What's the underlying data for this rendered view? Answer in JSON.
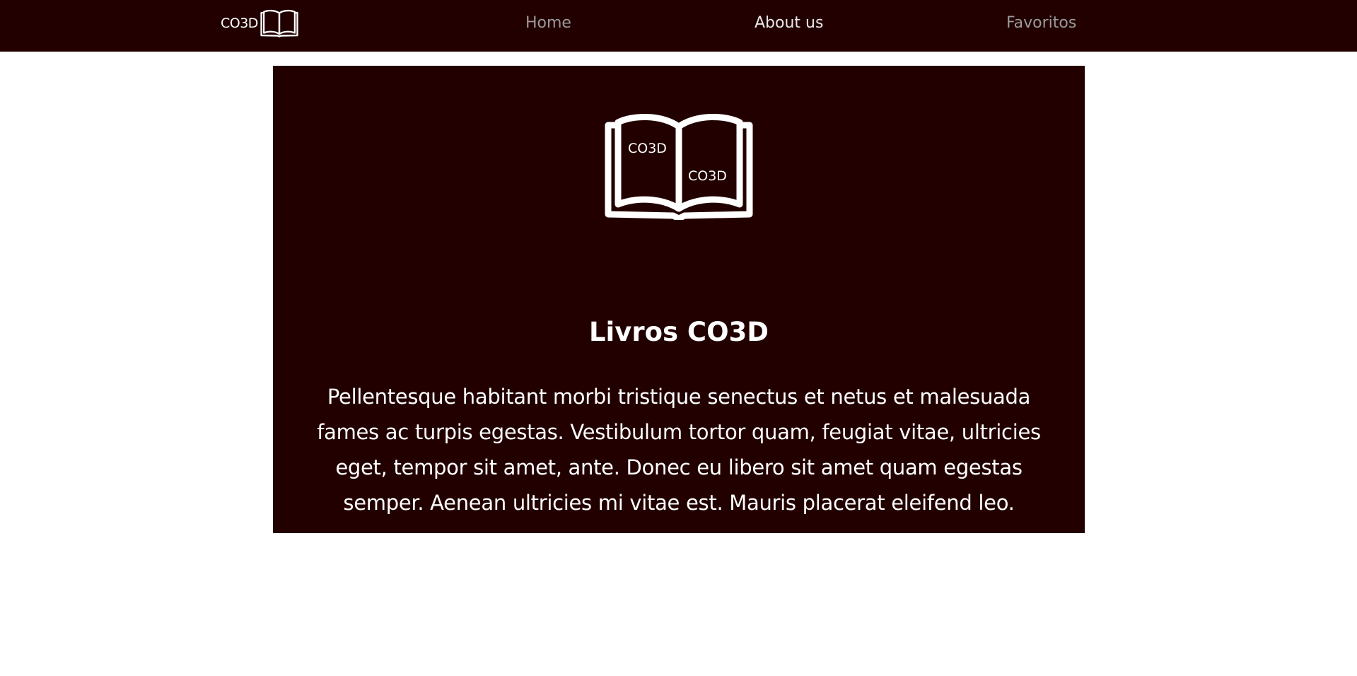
{
  "nav": {
    "brand_text": "CO3D",
    "brand_logo_icon": "open-book-icon",
    "links": [
      {
        "label": "Home",
        "state": "inactive"
      },
      {
        "label": "About us",
        "state": "active"
      },
      {
        "label": "Favoritos",
        "state": "inactive"
      }
    ]
  },
  "hero": {
    "logo_icon": "open-book-icon",
    "logo_left_label": "CO3D",
    "logo_right_label": "CO3D",
    "title": "Livros CO3D",
    "description": "Pellentesque habitant morbi tristique senectus et netus et malesuada fames ac turpis egestas. Vestibulum tortor quam, feugiat vitae, ultricies eget, tempor sit amet, ante. Donec eu libero sit amet quam egestas semper. Aenean ultricies mi vitae est. Mauris placerat eleifend leo."
  },
  "colors": {
    "navbar_background": "#220000",
    "hero_background": "#220000",
    "page_background": "#ffffff",
    "inactive_link": "#9a9a9a",
    "active_link": "#e8e8e8"
  }
}
